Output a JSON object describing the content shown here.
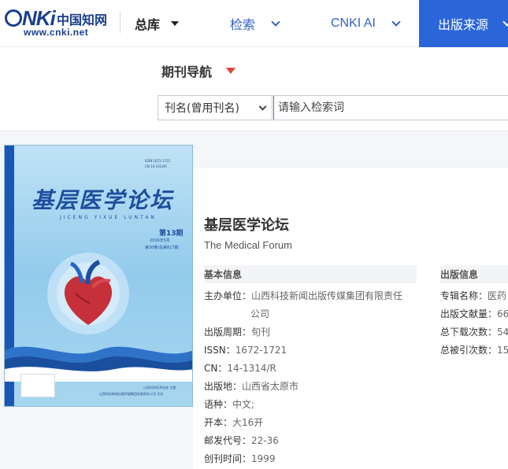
{
  "header": {
    "logo_text": "CNKi中国知网",
    "logo_cn": "中国知网",
    "logo_url": "www.cnki.net",
    "nav": {
      "zongku": "总库",
      "jiansuo": "检索",
      "cnki_ai": "CNKI AI",
      "source": "出版来源"
    }
  },
  "search": {
    "journal_nav": "期刊导航",
    "field_select": "刊名(曾用刊名)",
    "placeholder": "请输入检索词"
  },
  "cover": {
    "title": "基层医学论坛",
    "pinyin": "JICENG YIXUE LUNTAN",
    "issue": "第13期",
    "date": "2026年5月",
    "volume": "第30卷/总第817期",
    "publisher_line1": "山西科学技术协会 主管",
    "publisher_line2": "山西科技新闻出版传媒集团有限责任公司 主办",
    "issn_small": "ISSN 1672-1721",
    "cn_small": "CN 14-1314/R"
  },
  "journal": {
    "title_cn": "基层医学论坛",
    "title_en": "The Medical Forum",
    "basic_info_heading": "基本信息",
    "pub_info_heading": "出版信息",
    "basic": [
      {
        "label": "主办单位：",
        "value": "山西科技新闻出版传媒集团有限责任",
        "value2": "公司"
      },
      {
        "label": "出版周期：",
        "value": "旬刊"
      },
      {
        "label": "ISSN：",
        "value": "1672-1721"
      },
      {
        "label": "CN：",
        "value": "14-1314/R"
      },
      {
        "label": "出版地：",
        "value": "山西省太原市"
      },
      {
        "label": "语种：",
        "value": "中文;"
      },
      {
        "label": "开本：",
        "value": "大16开"
      },
      {
        "label": "邮发代号：",
        "value": "22-36"
      },
      {
        "label": "创刊时间：",
        "value": "1999"
      }
    ],
    "pub": [
      {
        "label": "专辑名称：",
        "value": "医药"
      },
      {
        "label": "出版文献量：",
        "value": "66"
      },
      {
        "label": "总下载次数：",
        "value": "54"
      },
      {
        "label": "总被引次数：",
        "value": "15"
      }
    ]
  },
  "colors": {
    "brand_blue": "#2b66d9",
    "link_blue": "#2f63c9",
    "accent_red": "#e0453a"
  }
}
